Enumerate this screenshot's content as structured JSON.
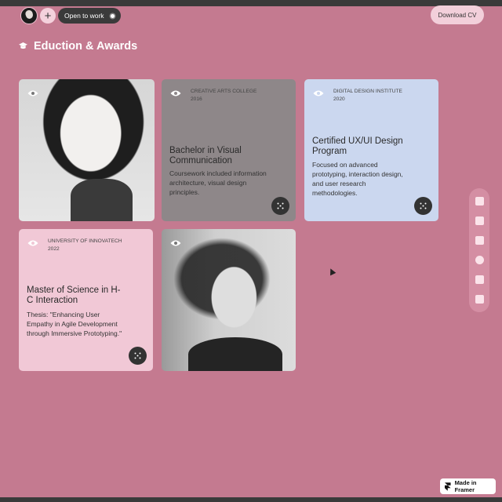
{
  "header": {
    "status": "Open to work",
    "add_label": "+",
    "download_label": "Download CV"
  },
  "section": {
    "title": "Eduction & Awards"
  },
  "cards": [
    {
      "institution": "CREATIVE ARTS COLLEGE",
      "year": "2016",
      "title": "Bachelor in Visual Communication",
      "description": "Coursework included information architecture, visual design principles.",
      "color": "#8e8789"
    },
    {
      "institution": "DIGITAL DESIGN INSTITUTE",
      "year": "2020",
      "title": "Certified UX/UI Design Program",
      "description": "Focused on advanced prototyping, interaction design, and user research methodologies.",
      "color": "#cbd7ef"
    },
    {
      "institution": "UNIVERSITY OF INNOVATECH",
      "year": "2022",
      "title": "Master of Science in H-C Interaction",
      "description": "Thesis: \"Enhancing User Empathy in Agile Development through Immersive Prototyping.\"",
      "color": "#f1c8d6"
    }
  ],
  "badge": {
    "label": "Made in Framer"
  },
  "icons": {
    "section": "graduation-cap-icon",
    "card": "eye-icon",
    "expand": "expand-icon"
  }
}
